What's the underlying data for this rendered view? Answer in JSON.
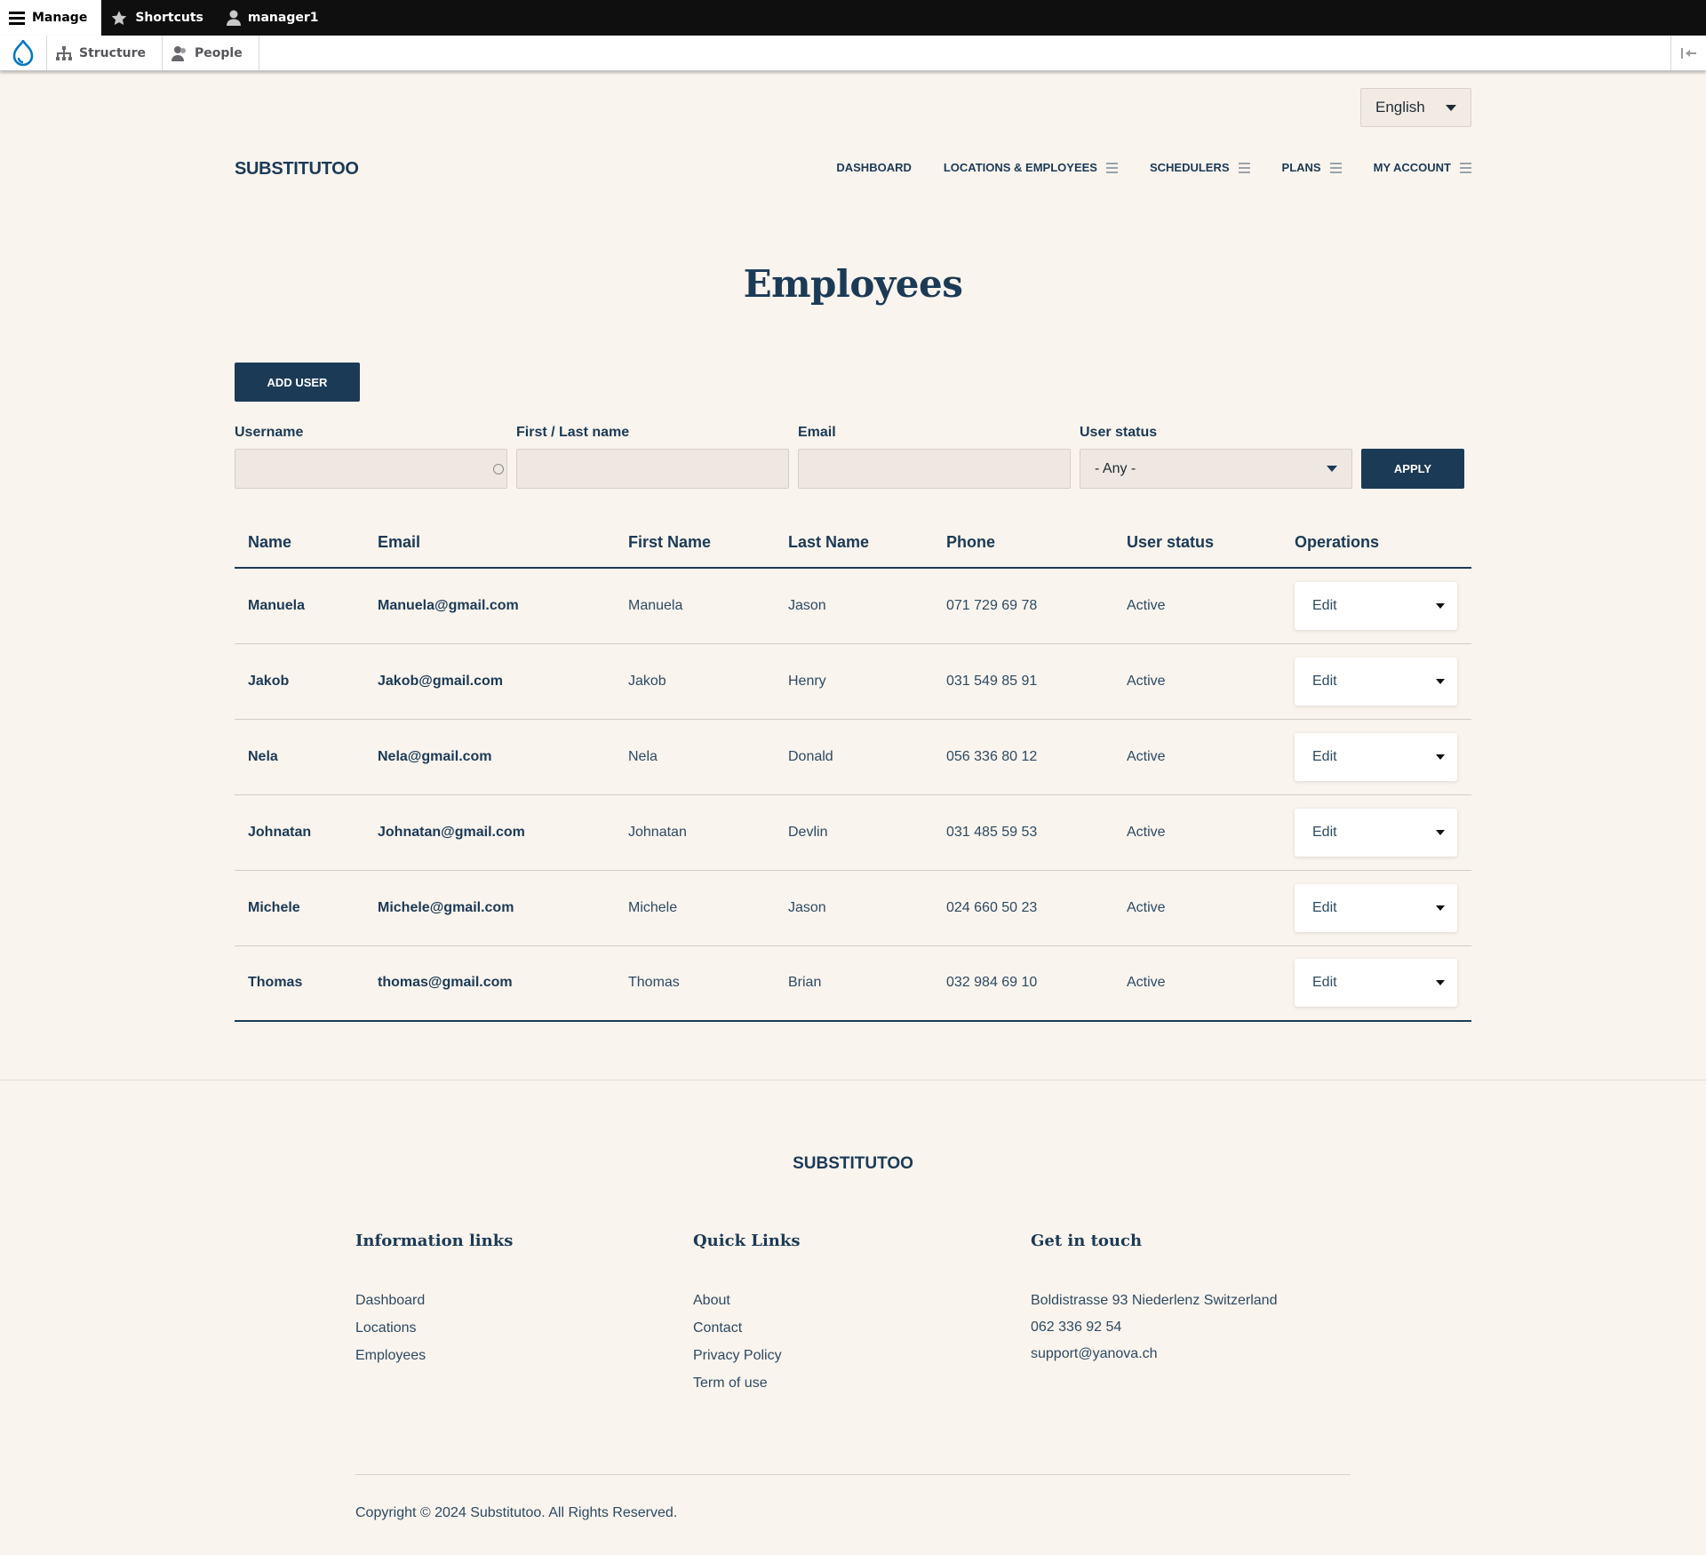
{
  "admin_toolbar": {
    "manage": "Manage",
    "shortcuts": "Shortcuts",
    "user": "manager1"
  },
  "admin_tray": {
    "structure": "Structure",
    "people": "People"
  },
  "language": {
    "selected": "English"
  },
  "header": {
    "logo": "SUBSTITUTOO",
    "nav": [
      {
        "label": "DASHBOARD"
      },
      {
        "label": "LOCATIONS & EMPLOYEES"
      },
      {
        "label": "SCHEDULERS"
      },
      {
        "label": "PLANS"
      },
      {
        "label": "MY ACCOUNT"
      }
    ]
  },
  "page": {
    "title": "Employees",
    "add_user": "ADD USER"
  },
  "filters": {
    "username_label": "Username",
    "name_label": "First / Last name",
    "email_label": "Email",
    "status_label": "User status",
    "status_selected": "- Any -",
    "apply": "APPLY"
  },
  "table": {
    "headers": [
      "Name",
      "Email",
      "First Name",
      "Last Name",
      "Phone",
      "User status",
      "Operations"
    ],
    "rows": [
      {
        "name": "Manuela",
        "email": "Manuela@gmail.com",
        "first": "Manuela",
        "last": "Jason",
        "phone": "071 729 69 78",
        "status": "Active",
        "op": "Edit"
      },
      {
        "name": "Jakob",
        "email": "Jakob@gmail.com",
        "first": "Jakob",
        "last": "Henry",
        "phone": "031 549 85 91",
        "status": "Active",
        "op": "Edit"
      },
      {
        "name": "Nela",
        "email": "Nela@gmail.com",
        "first": "Nela",
        "last": "Donald",
        "phone": "056 336 80 12",
        "status": "Active",
        "op": "Edit"
      },
      {
        "name": "Johnatan",
        "email": "Johnatan@gmail.com",
        "first": "Johnatan",
        "last": "Devlin",
        "phone": "031 485 59 53",
        "status": "Active",
        "op": "Edit"
      },
      {
        "name": "Michele",
        "email": "Michele@gmail.com",
        "first": "Michele",
        "last": "Jason",
        "phone": "024 660 50 23",
        "status": "Active",
        "op": "Edit"
      },
      {
        "name": "Thomas",
        "email": "thomas@gmail.com",
        "first": "Thomas",
        "last": "Brian",
        "phone": "032 984 69 10",
        "status": "Active",
        "op": "Edit"
      }
    ]
  },
  "footer": {
    "logo": "SUBSTITUTOO",
    "info_title": "Information links",
    "info_links": [
      "Dashboard",
      "Locations",
      "Employees"
    ],
    "quick_title": "Quick Links",
    "quick_links": [
      "About",
      "Contact",
      "Privacy Policy",
      "Term of use"
    ],
    "touch_title": "Get in touch",
    "touch_lines": [
      "Boldistrasse 93 Niederlenz Switzerland",
      "062 336 92 54",
      "support@yanova.ch"
    ],
    "copyright": "Copyright © 2024 Substitutoo. All Rights Reserved."
  },
  "colors": {
    "brand_navy": "#1b3a56",
    "page_bg": "#faf4ee",
    "admin_bar": "#0f0f0f",
    "drupal_blue": "#0678be"
  }
}
